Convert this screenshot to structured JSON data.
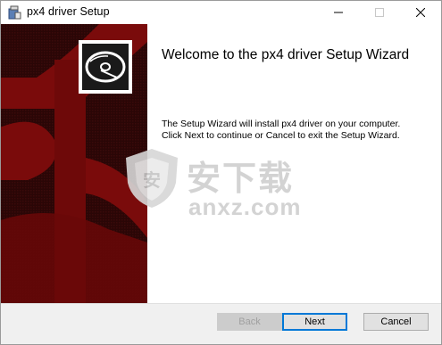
{
  "window": {
    "title": "px4 driver Setup"
  },
  "controls": {
    "minimize": "—",
    "maximize": "☐",
    "close": "✕"
  },
  "wizard": {
    "heading": "Welcome to the px4 driver Setup Wizard",
    "description_line1": "The Setup Wizard will install px4 driver on your computer.",
    "description_line2": "Click Next to continue or Cancel to exit the Setup Wizard."
  },
  "buttons": {
    "back": "Back",
    "next": "Next",
    "cancel": "Cancel"
  },
  "watermark": {
    "cn": "安下载",
    "site": "anxz.com"
  },
  "colors": {
    "banner_dark": "#2a0606",
    "banner_red": "#7a0b0b",
    "accent": "#0078d7"
  },
  "icons": {
    "app": "installer-icon",
    "disc": "cd-disc-icon"
  }
}
